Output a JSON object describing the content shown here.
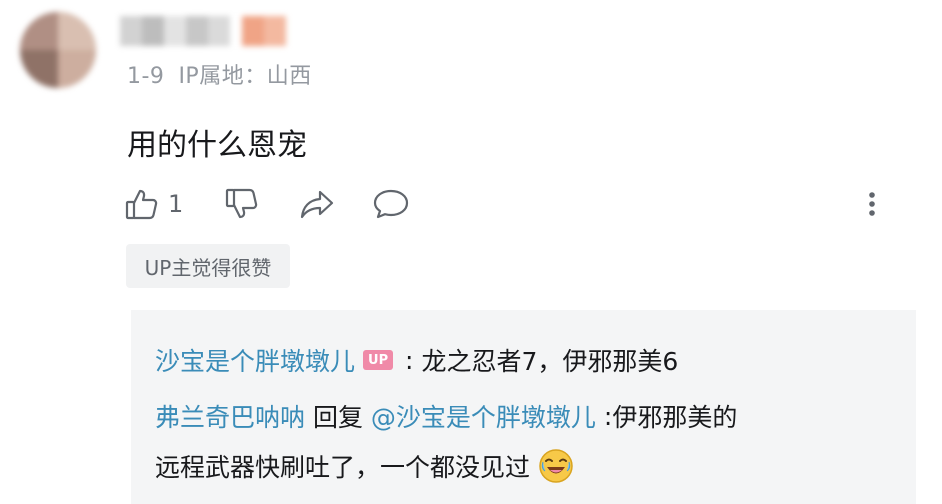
{
  "comment": {
    "meta": {
      "date": "1-9",
      "ip_location": "IP属地：山西"
    },
    "text": "用的什么恩宠",
    "actions": {
      "like_icon": "thumbs-up-icon",
      "like_count": "1",
      "dislike_icon": "thumbs-down-icon",
      "share_icon": "share-icon",
      "reply_icon": "comment-icon",
      "more_icon": "more-vertical-icon"
    },
    "up_liked_label": "UP主觉得很赞"
  },
  "replies": [
    {
      "author": "沙宝是个胖墩墩儿",
      "badge": "UP",
      "separator": " : ",
      "text": "龙之忍者7，伊邪那美6"
    },
    {
      "author": "弗兰奇巴呐呐",
      "reply_word": " 回复 ",
      "mention": "@沙宝是个胖墩墩儿",
      "separator": " :",
      "text_line1": "伊邪那美的",
      "text_line2": "远程武器快刷吐了，一个都没见过",
      "emoji_icon": "laughing-crying-emoji-icon"
    }
  ],
  "colors": {
    "link": "#3a8cb8",
    "up_badge": "#f08aa8",
    "muted": "#9499a0",
    "reply_bg": "#f4f5f6"
  }
}
